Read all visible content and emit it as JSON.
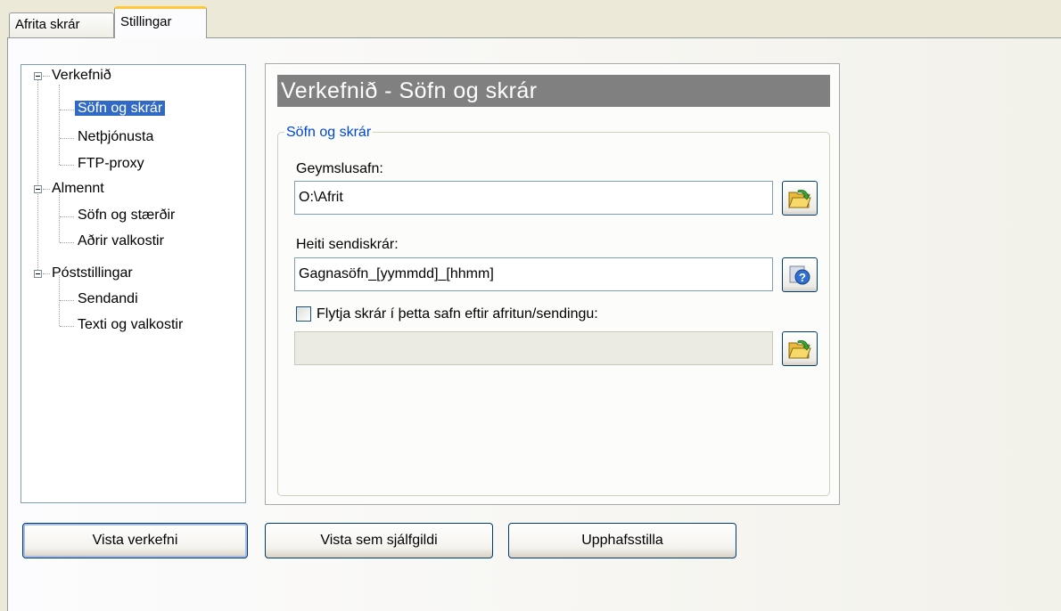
{
  "tabs": [
    {
      "label": "Afrita skrár"
    },
    {
      "label": "Stillingar"
    }
  ],
  "tree": {
    "groups": [
      {
        "label": "Verkefnið",
        "children": [
          {
            "label": "Söfn og skrár"
          },
          {
            "label": "Netþjónusta"
          },
          {
            "label": "FTP-proxy"
          }
        ]
      },
      {
        "label": "Almennt",
        "children": [
          {
            "label": "Söfn og stærðir"
          },
          {
            "label": "Aðrir valkostir"
          }
        ]
      },
      {
        "label": "Póststillingar",
        "children": [
          {
            "label": "Sendandi"
          },
          {
            "label": "Texti og valkostir"
          }
        ]
      }
    ],
    "selected": "Söfn og skrár"
  },
  "panel": {
    "title": "Verkefnið - Söfn og skrár",
    "group_label": "Söfn og skrár",
    "storage_label": "Geymslusafn:",
    "storage_value": "O:\\Afrit",
    "sendfile_label": "Heiti sendiskrár:",
    "sendfile_value": "Gagnasöfn_[yymmdd]_[hhmm]",
    "move_label": "Flytja skrár í þetta safn eftir afritun/sendingu:",
    "move_value": "",
    "move_checked": false
  },
  "buttons": {
    "save_project": "Vista verkefni",
    "save_default": "Vista sem sjálfgildi",
    "reset": "Upphafsstilla"
  },
  "icons": {
    "browse": "folder-open-icon",
    "help": "help-icon"
  }
}
